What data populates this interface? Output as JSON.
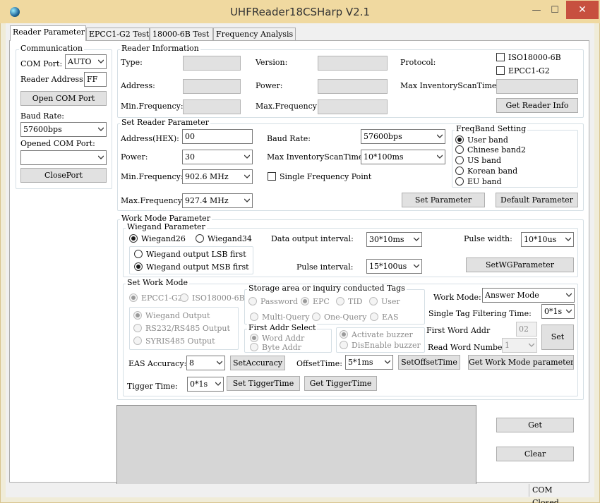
{
  "window": {
    "title": "UHFReader18CSHarp V2.1",
    "min_glyph": "—",
    "max_glyph": "☐",
    "close_glyph": "✕",
    "icon": "globe-app-icon"
  },
  "tabs": [
    "Reader Parameter",
    "EPCC1-G2 Test",
    "18000-6B Test",
    "Frequency Analysis"
  ],
  "communication": {
    "title": "Communication",
    "com_port_label": "COM Port:",
    "com_port_value": "AUTO",
    "reader_address_label": "Reader Address:",
    "reader_address_value": "FF",
    "open_button": "Open COM Port",
    "baud_rate_label": "Baud Rate:",
    "baud_rate_value": "57600bps",
    "opened_label": "Opened COM Port:",
    "opened_value": "",
    "close_button": "ClosePort"
  },
  "reader_info": {
    "title": "Reader Information",
    "type_label": "Type:",
    "version_label": "Version:",
    "protocol_label": "Protocol:",
    "address_label": "Address:",
    "power_label": "Power:",
    "max_inv_label": "Max InventoryScanTime:",
    "min_freq_label": "Min.Frequency:",
    "max_freq_label": "Max.Frequency:",
    "iso_label": "ISO18000-6B",
    "epc_label": "EPCC1-G2",
    "get_button": "Get Reader Info"
  },
  "set_param": {
    "title": "Set Reader Parameter",
    "address_label": "Address(HEX):",
    "address_value": "00",
    "baud_label": "Baud Rate:",
    "baud_value": "57600bps",
    "power_label": "Power:",
    "power_value": "30",
    "max_inv_label": "Max InventoryScanTime:",
    "max_inv_value": "10*100ms",
    "min_freq_label": "Min.Frequency:",
    "min_freq_value": "902.6 MHz",
    "single_freq_label": "Single Frequency Point",
    "max_freq_label": "Max.Frequency:",
    "max_freq_value": "927.4 MHz",
    "set_button": "Set Parameter",
    "default_button": "Default Parameter",
    "freqband_title": "FreqBand Setting",
    "bands": [
      "User band",
      "Chinese band2",
      "US band",
      "Korean band",
      "EU band"
    ],
    "selected_band": 0
  },
  "work_mode": {
    "title": "Work Mode Parameter",
    "wiegand_title": "Wiegand Parameter",
    "wiegand26": "Wiegand26",
    "wiegand34": "Wiegand34",
    "lsb": "Wiegand output LSB first",
    "msb": "Wiegand output MSB first",
    "data_interval_label": "Data output interval:",
    "data_interval_value": "30*10ms",
    "pulse_width_label": "Pulse width:",
    "pulse_width_value": "10*10us",
    "pulse_interval_label": "Pulse interval:",
    "pulse_interval_value": "15*100us",
    "setwg_button": "SetWGParameter",
    "set_work_mode_title": "Set Work Mode",
    "epc_mode": "EPCC1-G2",
    "iso_mode": "ISO18000-6B",
    "wiegand_output": "Wiegand Output",
    "rs232_output": "RS232/RS485 Output",
    "syris_output": "SYRIS485 Output",
    "storage_title": "Storage area or inquiry conducted Tags",
    "password": "Password",
    "epc": "EPC",
    "tid": "TID",
    "user": "User",
    "multi_query": "Multi-Query",
    "one_query": "One-Query",
    "eas": "EAS",
    "first_addr_title": "First Addr Select",
    "word_addr": "Word Addr",
    "byte_addr": "Byte Addr",
    "activate_buzzer": "Activate buzzer",
    "disable_buzzer": "DisEnable buzzer",
    "work_mode_label": "Work Mode:",
    "work_mode_value": "Answer Mode",
    "single_tag_label": "Single Tag Filtering Time:",
    "single_tag_value": "0*1s",
    "first_word_label": "First Word Addr",
    "first_word_value": "02",
    "read_word_label": "Read Word Number:",
    "read_word_value": "1",
    "set_button": "Set",
    "eas_accuracy_label": "EAS Accuracy:",
    "eas_accuracy_value": "8",
    "set_accuracy_button": "SetAccuracy",
    "offset_label": "OffsetTime:",
    "offset_value": "5*1ms",
    "set_offset_button": "SetOffsetTime",
    "get_work_mode_button": "Get Work Mode parameter",
    "tigger_label": "Tigger Time:",
    "tigger_value": "0*1s",
    "set_tigger_button": "Set TiggerTime",
    "get_tigger_button": "Get TiggerTime"
  },
  "log": {
    "get_button": "Get",
    "clear_button": "Clear"
  },
  "status": {
    "text": "COM Closed"
  }
}
